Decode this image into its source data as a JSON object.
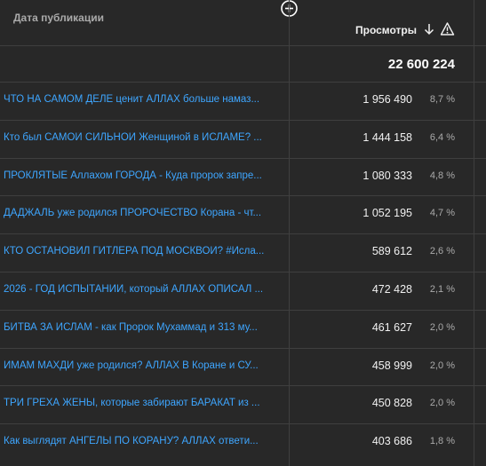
{
  "header": {
    "date_label": "Дата публикации",
    "views_label": "Просмотры",
    "add_column_icon": "plus-circle-icon",
    "sort_icon": "arrow-down-icon",
    "warning_icon": "warning-triangle-icon"
  },
  "total": {
    "views": "22 600 224"
  },
  "rows": [
    {
      "title": "ЧТО НА САМОМ ДЕЛЕ ценит АЛЛАХ больше намаз...",
      "views": "1 956 490",
      "pct": "8,7 %"
    },
    {
      "title": "Кто был САМОЙ СИЛЬНОЙ Женщиной в ИСЛАМЕ? ...",
      "views": "1 444 158",
      "pct": "6,4 %"
    },
    {
      "title": "ПРОКЛЯТЫЕ Аллахом ГОРОДА - Куда пророк запре...",
      "views": "1 080 333",
      "pct": "4,8 %"
    },
    {
      "title": "ДАДЖАЛЬ уже родился ПРОРОЧЕСТВО Корана - чт...",
      "views": "1 052 195",
      "pct": "4,7 %"
    },
    {
      "title": "КТО ОСТАНОВИЛ ГИТЛЕРА ПОД МОСКВОЙ? #Исла...",
      "views": "589 612",
      "pct": "2,6 %"
    },
    {
      "title": "2026 - ГОД ИСПЫТАНИЙ, который АЛЛАХ ОПИСАЛ ...",
      "views": "472 428",
      "pct": "2,1 %"
    },
    {
      "title": "БИТВА ЗА ИСЛАМ - как Пророк Мухаммад и 313 му...",
      "views": "461 627",
      "pct": "2,0 %"
    },
    {
      "title": "ИМАМ МАХДИ уже родился? АЛЛАХ В Коране и СУ...",
      "views": "458 999",
      "pct": "2,0 %"
    },
    {
      "title": "ТРИ ГРЕХА ЖЕНЫ, которые забирают БАРАКАТ из ...",
      "views": "450 828",
      "pct": "2,0 %"
    },
    {
      "title": "Как выглядят АНГЕЛЫ ПО КОРАНУ? АЛЛАХ ответи...",
      "views": "403 686",
      "pct": "1,8 %"
    }
  ],
  "colors": {
    "background": "#282828",
    "link": "#3ea6ff",
    "divider": "#3f3f3f"
  }
}
